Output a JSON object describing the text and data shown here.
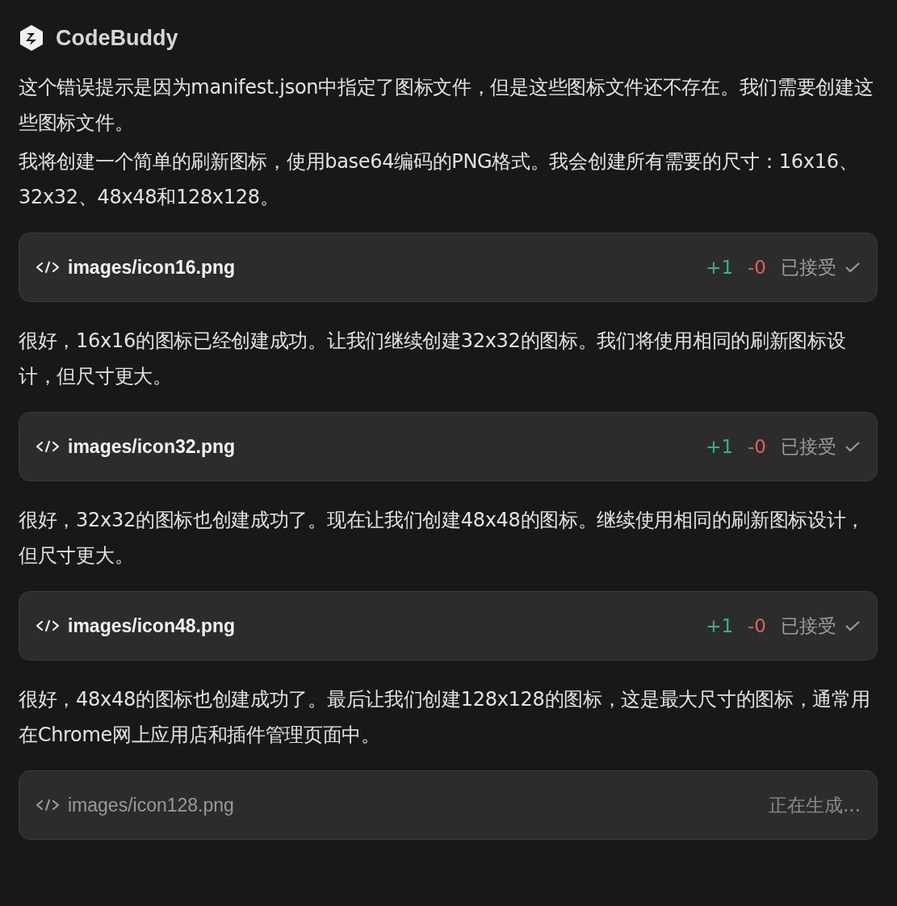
{
  "header": {
    "title": "CodeBuddy"
  },
  "messages": [
    {
      "kind": "text",
      "text": "这个错误提示是因为manifest.json中指定了图标文件，但是这些图标文件还不存在。我们需要创建这些图标文件。"
    },
    {
      "kind": "text",
      "text": "我将创建一个简单的刷新图标，使用base64编码的PNG格式。我会创建所有需要的尺寸：16x16、32x32、48x48和128x128。"
    },
    {
      "kind": "file",
      "path": "images/icon16.png",
      "done": true,
      "added": "+1",
      "removed": "-0",
      "status": "已接受"
    },
    {
      "kind": "text",
      "text": "很好，16x16的图标已经创建成功。让我们继续创建32x32的图标。我们将使用相同的刷新图标设计，但尺寸更大。"
    },
    {
      "kind": "file",
      "path": "images/icon32.png",
      "done": true,
      "added": "+1",
      "removed": "-0",
      "status": "已接受"
    },
    {
      "kind": "text",
      "text": "很好，32x32的图标也创建成功了。现在让我们创建48x48的图标。继续使用相同的刷新图标设计，但尺寸更大。"
    },
    {
      "kind": "file",
      "path": "images/icon48.png",
      "done": true,
      "added": "+1",
      "removed": "-0",
      "status": "已接受"
    },
    {
      "kind": "text",
      "text": "很好，48x48的图标也创建成功了。最后让我们创建128x128的图标，这是最大尺寸的图标，通常用在Chrome网上应用店和插件管理页面中。"
    },
    {
      "kind": "file",
      "path": "images/icon128.png",
      "done": false,
      "status": "正在生成..."
    }
  ]
}
